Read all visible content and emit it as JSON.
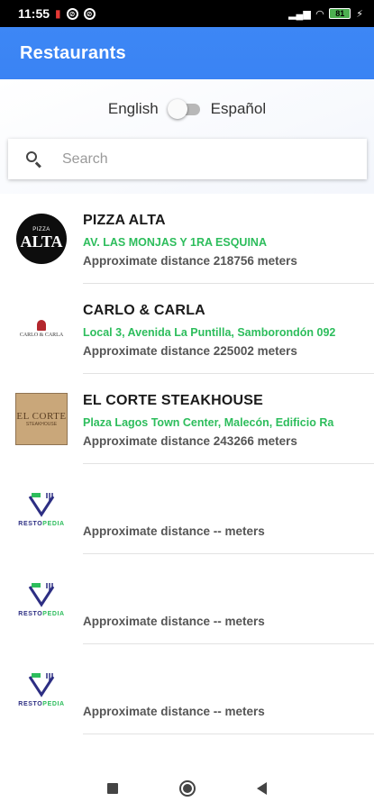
{
  "status_bar": {
    "time": "11:55",
    "battery": "81",
    "battery_color": "#4caf50"
  },
  "app_bar": {
    "title": "Restaurants",
    "color": "#3b82f6"
  },
  "language": {
    "left_label": "English",
    "right_label": "Español",
    "selected": "English"
  },
  "search": {
    "placeholder": "Search",
    "value": ""
  },
  "restaurants": [
    {
      "name": "PIZZA ALTA",
      "address": "AV. LAS MONJAS Y 1RA ESQUINA",
      "distance": "Approximate distance 218756 meters",
      "logo": "pizza-alta-logo"
    },
    {
      "name": "CARLO & CARLA",
      "address": "Local 3, Avenida La Puntilla, Samborondón 092",
      "distance": "Approximate distance 225002 meters",
      "logo": "carlo-carla-logo"
    },
    {
      "name": "EL CORTE STEAKHOUSE",
      "address": "Plaza Lagos Town Center, Malecón, Edificio Ra",
      "distance": "Approximate distance 243266 meters",
      "logo": "el-corte-logo"
    },
    {
      "name": "",
      "address": "",
      "distance": "Approximate distance -- meters",
      "logo": "restopedia-logo"
    },
    {
      "name": "",
      "address": "",
      "distance": "Approximate distance -- meters",
      "logo": "restopedia-logo"
    },
    {
      "name": "",
      "address": "",
      "distance": "Approximate distance -- meters",
      "logo": "restopedia-logo"
    }
  ],
  "logos": {
    "pizza_small": "PIZZA",
    "pizza_big": "ALTA",
    "carlo_text": "CARLO & CARLA",
    "corte_text": "EL CORTE",
    "corte_sub": "STEAKHOUSE",
    "resto_a": "RESTO",
    "resto_b": "PEDIA"
  },
  "colors": {
    "address_green": "#2dbd5c",
    "resto_navy": "#2d2e83"
  }
}
